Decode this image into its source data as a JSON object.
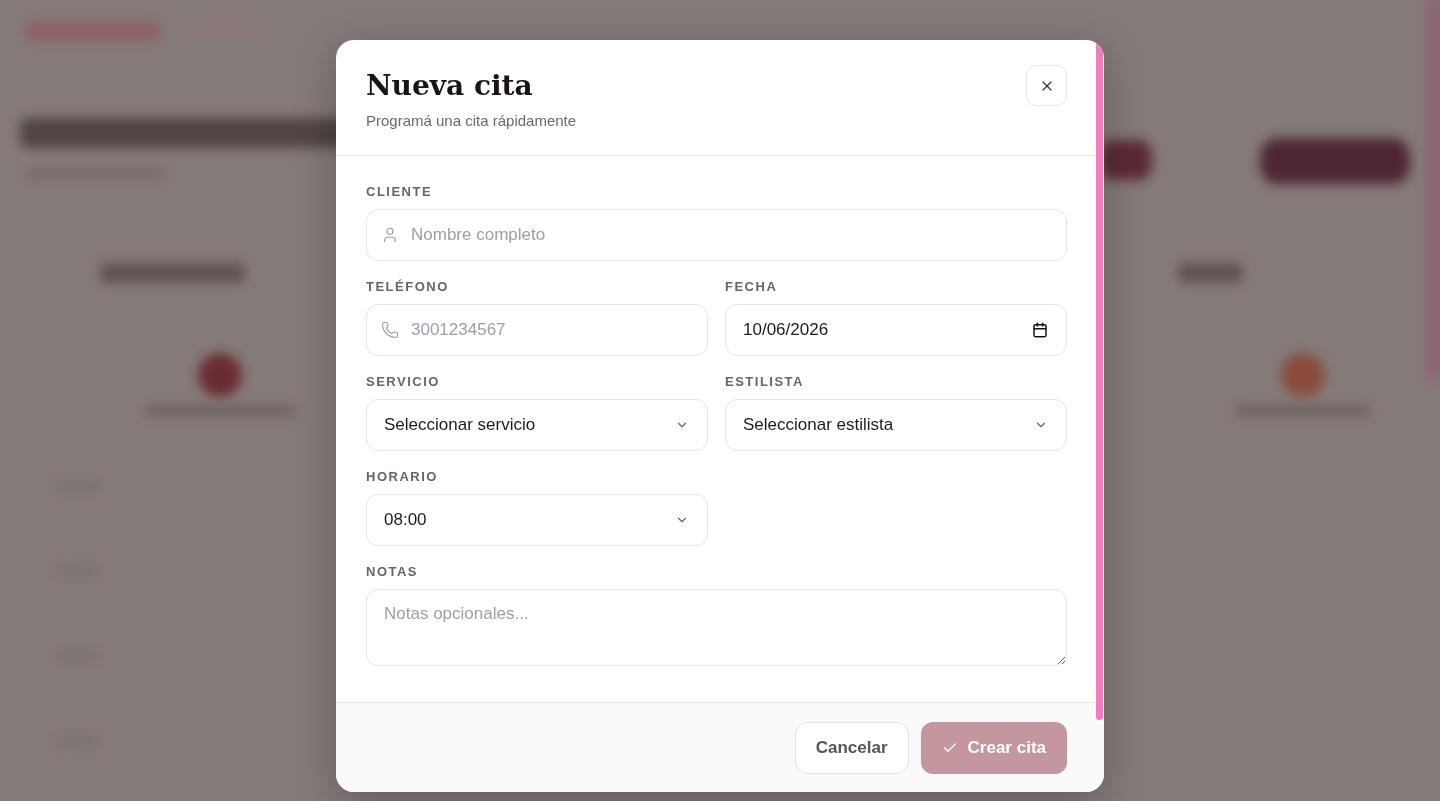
{
  "dialog": {
    "title": "Nueva cita",
    "subtitle": "Programá una cita rápidamente",
    "rows": [
      [
        {
          "kind": "person",
          "label": "CLIENTE",
          "placeholder": "Nombre completo"
        }
      ],
      [
        {
          "kind": "phone",
          "label": "TELÉFONO",
          "placeholder": "3001234567"
        },
        {
          "kind": "date",
          "label": "FECHA",
          "value": "10/06/2026"
        }
      ],
      [
        {
          "kind": "select",
          "label": "SERVICIO",
          "value": "Seleccionar servicio"
        },
        {
          "kind": "select",
          "label": "ESTILISTA",
          "value": "Seleccionar estilista"
        }
      ],
      [
        {
          "kind": "select",
          "label": "HORARIO",
          "value": "08:00"
        }
      ],
      [
        {
          "kind": "textarea",
          "label": "NOTAS",
          "placeholder": "Notas opcionales..."
        }
      ]
    ],
    "buttons": [
      {
        "kind": "secondary",
        "label": "Cancelar",
        "disabled": false
      },
      {
        "kind": "primary",
        "label": "Crear cita",
        "disabled": true
      }
    ]
  }
}
